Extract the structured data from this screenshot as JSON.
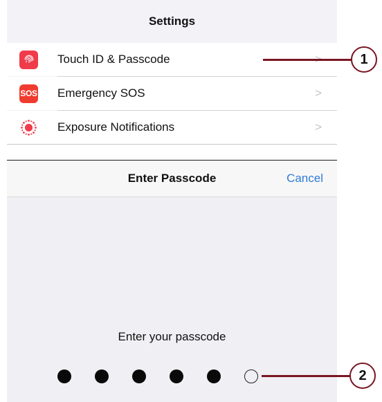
{
  "settings": {
    "title": "Settings",
    "items": [
      {
        "label": "Touch ID & Passcode",
        "icon": "fingerprint-icon"
      },
      {
        "label": "Emergency SOS",
        "icon": "sos-icon",
        "badge": "SOS"
      },
      {
        "label": "Exposure Notifications",
        "icon": "exposure-icon"
      }
    ],
    "chevron": ">"
  },
  "passcode": {
    "title": "Enter Passcode",
    "cancel": "Cancel",
    "prompt": "Enter your passcode",
    "digits_entered": 5,
    "digits_total": 6
  },
  "callouts": [
    {
      "number": "1"
    },
    {
      "number": "2"
    }
  ],
  "colors": {
    "accent": "#2f7bd7",
    "callout": "#7a1522",
    "touchid": "#f03b4a",
    "sos": "#f03b2f"
  }
}
